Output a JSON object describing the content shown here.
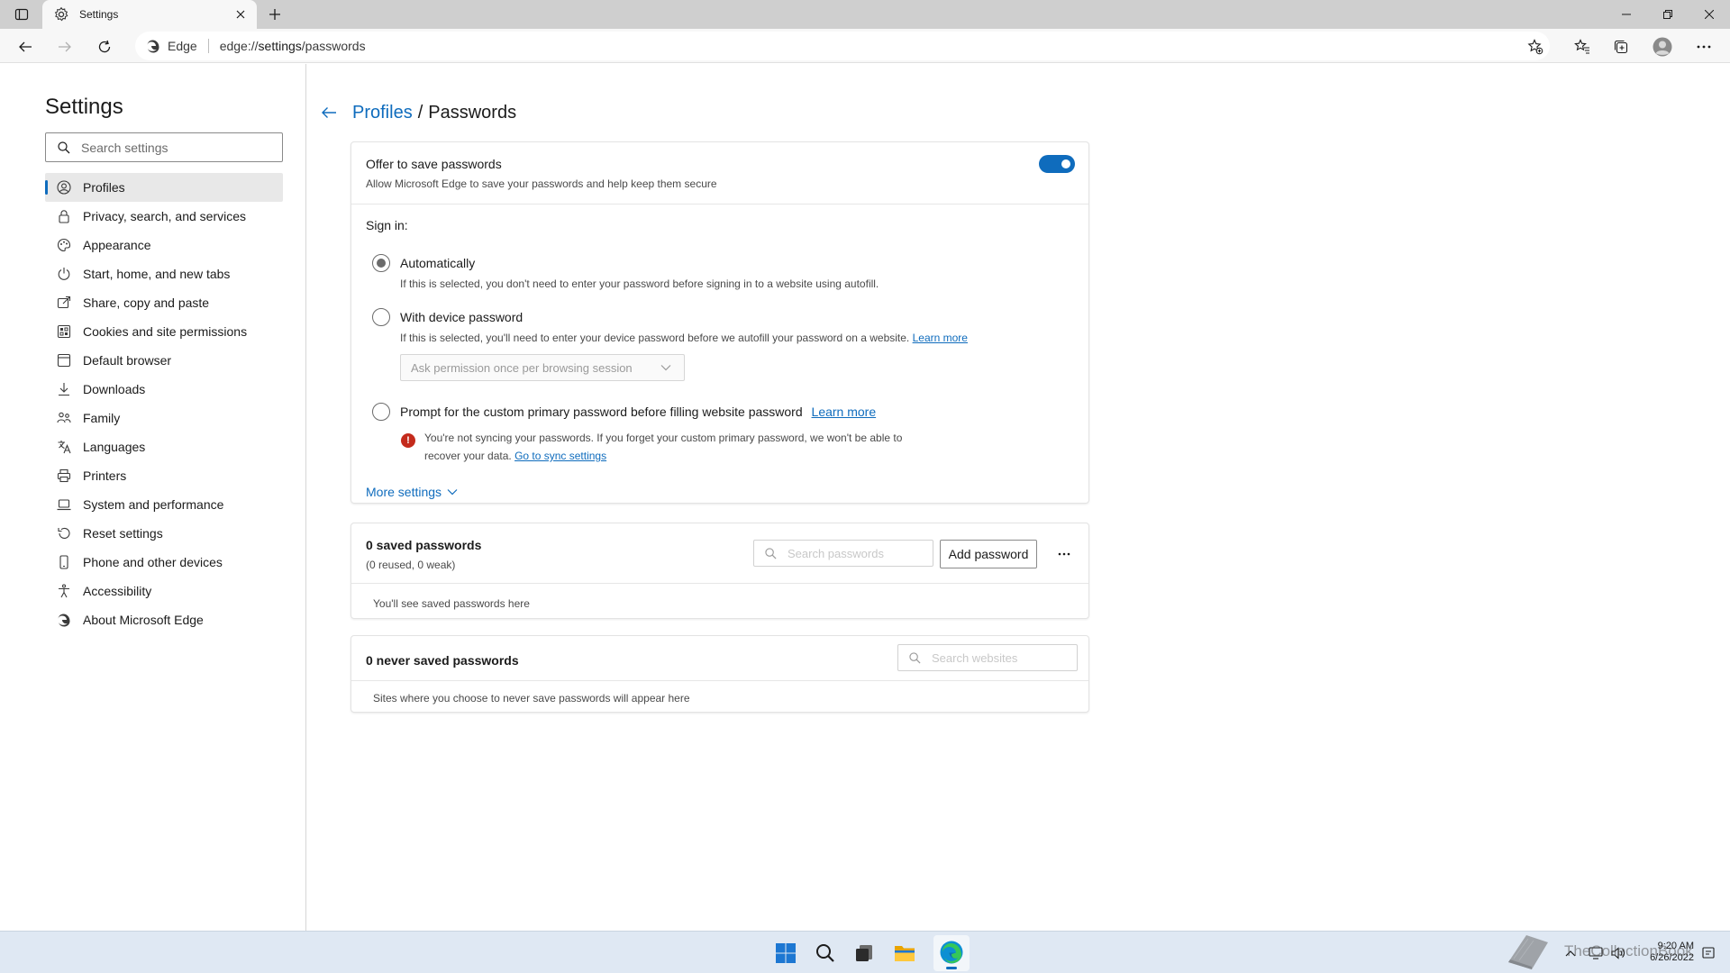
{
  "browser": {
    "tab_title": "Settings",
    "site_label": "Edge",
    "url_prefix": "edge://",
    "url_main": "settings",
    "url_suffix": "/passwords"
  },
  "sidebar": {
    "title": "Settings",
    "search_placeholder": "Search settings",
    "items": [
      {
        "label": "Profiles",
        "icon": "profile-icon",
        "active": true
      },
      {
        "label": "Privacy, search, and services",
        "icon": "lock-icon"
      },
      {
        "label": "Appearance",
        "icon": "appearance-icon"
      },
      {
        "label": "Start, home, and new tabs",
        "icon": "power-icon"
      },
      {
        "label": "Share, copy and paste",
        "icon": "share-icon"
      },
      {
        "label": "Cookies and site permissions",
        "icon": "permissions-icon"
      },
      {
        "label": "Default browser",
        "icon": "browser-icon"
      },
      {
        "label": "Downloads",
        "icon": "download-icon"
      },
      {
        "label": "Family",
        "icon": "family-icon"
      },
      {
        "label": "Languages",
        "icon": "language-icon"
      },
      {
        "label": "Printers",
        "icon": "printer-icon"
      },
      {
        "label": "System and performance",
        "icon": "laptop-icon"
      },
      {
        "label": "Reset settings",
        "icon": "reset-icon"
      },
      {
        "label": "Phone and other devices",
        "icon": "phone-icon"
      },
      {
        "label": "Accessibility",
        "icon": "accessibility-icon"
      },
      {
        "label": "About Microsoft Edge",
        "icon": "edge-icon"
      }
    ]
  },
  "breadcrumb": {
    "parent": "Profiles",
    "separator": "/",
    "current": "Passwords"
  },
  "offer": {
    "title": "Offer to save passwords",
    "subtitle": "Allow Microsoft Edge to save your passwords and help keep them secure",
    "enabled": true
  },
  "signin": {
    "label": "Sign in:",
    "auto_label": "Automatically",
    "auto_desc": "If this is selected, you don't need to enter your password before signing in to a website using autofill.",
    "device_label": "With device password",
    "device_desc": "If this is selected, you'll need to enter your device password before we autofill your password on a website.",
    "device_learn_more": "Learn more",
    "device_select_value": "Ask permission once per browsing session",
    "custom_label": "Prompt for the custom primary password before filling website password",
    "custom_learn_more": "Learn more",
    "warning_text": "You're not syncing your passwords. If you forget your custom primary password, we won't be able to recover your data.",
    "warning_link": "Go to sync settings",
    "selected": "Automatically"
  },
  "more_settings_label": "More settings",
  "saved": {
    "title": "0 saved passwords",
    "subtitle": "(0 reused, 0 weak)",
    "search_placeholder": "Search passwords",
    "add_button": "Add password",
    "empty_text": "You'll see saved passwords here"
  },
  "never_saved": {
    "title": "0 never saved passwords",
    "search_placeholder": "Search websites",
    "empty_text": "Sites where you choose to never save passwords will appear here"
  },
  "taskbar": {
    "time": "9:20 AM",
    "date": "6/26/2022",
    "watermark": "TheCollectionBook"
  },
  "colors": {
    "accent": "#0f6cbd",
    "error": "#c42b1c",
    "taskbar": "#dfe8f3"
  }
}
